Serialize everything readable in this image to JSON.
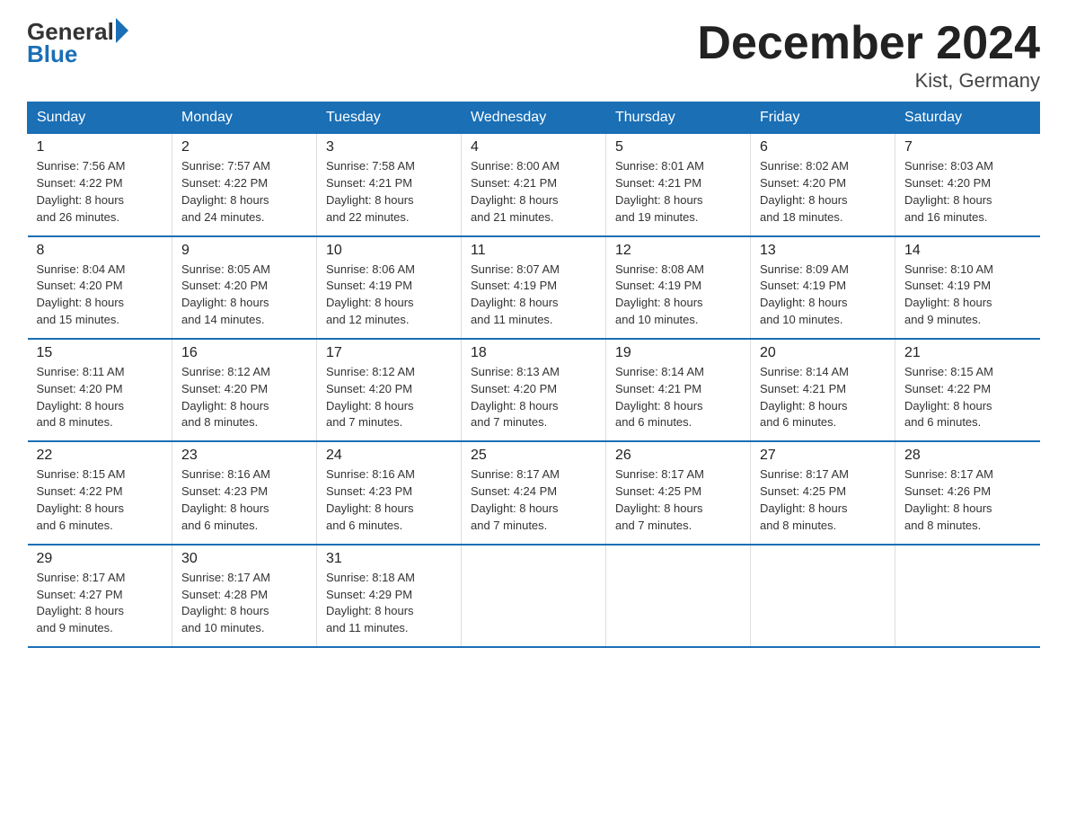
{
  "header": {
    "logo_general": "General",
    "logo_blue": "Blue",
    "month_title": "December 2024",
    "location": "Kist, Germany"
  },
  "weekdays": [
    "Sunday",
    "Monday",
    "Tuesday",
    "Wednesday",
    "Thursday",
    "Friday",
    "Saturday"
  ],
  "weeks": [
    [
      {
        "day": "1",
        "sunrise": "7:56 AM",
        "sunset": "4:22 PM",
        "daylight": "8 hours and 26 minutes."
      },
      {
        "day": "2",
        "sunrise": "7:57 AM",
        "sunset": "4:22 PM",
        "daylight": "8 hours and 24 minutes."
      },
      {
        "day": "3",
        "sunrise": "7:58 AM",
        "sunset": "4:21 PM",
        "daylight": "8 hours and 22 minutes."
      },
      {
        "day": "4",
        "sunrise": "8:00 AM",
        "sunset": "4:21 PM",
        "daylight": "8 hours and 21 minutes."
      },
      {
        "day": "5",
        "sunrise": "8:01 AM",
        "sunset": "4:21 PM",
        "daylight": "8 hours and 19 minutes."
      },
      {
        "day": "6",
        "sunrise": "8:02 AM",
        "sunset": "4:20 PM",
        "daylight": "8 hours and 18 minutes."
      },
      {
        "day": "7",
        "sunrise": "8:03 AM",
        "sunset": "4:20 PM",
        "daylight": "8 hours and 16 minutes."
      }
    ],
    [
      {
        "day": "8",
        "sunrise": "8:04 AM",
        "sunset": "4:20 PM",
        "daylight": "8 hours and 15 minutes."
      },
      {
        "day": "9",
        "sunrise": "8:05 AM",
        "sunset": "4:20 PM",
        "daylight": "8 hours and 14 minutes."
      },
      {
        "day": "10",
        "sunrise": "8:06 AM",
        "sunset": "4:19 PM",
        "daylight": "8 hours and 12 minutes."
      },
      {
        "day": "11",
        "sunrise": "8:07 AM",
        "sunset": "4:19 PM",
        "daylight": "8 hours and 11 minutes."
      },
      {
        "day": "12",
        "sunrise": "8:08 AM",
        "sunset": "4:19 PM",
        "daylight": "8 hours and 10 minutes."
      },
      {
        "day": "13",
        "sunrise": "8:09 AM",
        "sunset": "4:19 PM",
        "daylight": "8 hours and 10 minutes."
      },
      {
        "day": "14",
        "sunrise": "8:10 AM",
        "sunset": "4:19 PM",
        "daylight": "8 hours and 9 minutes."
      }
    ],
    [
      {
        "day": "15",
        "sunrise": "8:11 AM",
        "sunset": "4:20 PM",
        "daylight": "8 hours and 8 minutes."
      },
      {
        "day": "16",
        "sunrise": "8:12 AM",
        "sunset": "4:20 PM",
        "daylight": "8 hours and 8 minutes."
      },
      {
        "day": "17",
        "sunrise": "8:12 AM",
        "sunset": "4:20 PM",
        "daylight": "8 hours and 7 minutes."
      },
      {
        "day": "18",
        "sunrise": "8:13 AM",
        "sunset": "4:20 PM",
        "daylight": "8 hours and 7 minutes."
      },
      {
        "day": "19",
        "sunrise": "8:14 AM",
        "sunset": "4:21 PM",
        "daylight": "8 hours and 6 minutes."
      },
      {
        "day": "20",
        "sunrise": "8:14 AM",
        "sunset": "4:21 PM",
        "daylight": "8 hours and 6 minutes."
      },
      {
        "day": "21",
        "sunrise": "8:15 AM",
        "sunset": "4:22 PM",
        "daylight": "8 hours and 6 minutes."
      }
    ],
    [
      {
        "day": "22",
        "sunrise": "8:15 AM",
        "sunset": "4:22 PM",
        "daylight": "8 hours and 6 minutes."
      },
      {
        "day": "23",
        "sunrise": "8:16 AM",
        "sunset": "4:23 PM",
        "daylight": "8 hours and 6 minutes."
      },
      {
        "day": "24",
        "sunrise": "8:16 AM",
        "sunset": "4:23 PM",
        "daylight": "8 hours and 6 minutes."
      },
      {
        "day": "25",
        "sunrise": "8:17 AM",
        "sunset": "4:24 PM",
        "daylight": "8 hours and 7 minutes."
      },
      {
        "day": "26",
        "sunrise": "8:17 AM",
        "sunset": "4:25 PM",
        "daylight": "8 hours and 7 minutes."
      },
      {
        "day": "27",
        "sunrise": "8:17 AM",
        "sunset": "4:25 PM",
        "daylight": "8 hours and 8 minutes."
      },
      {
        "day": "28",
        "sunrise": "8:17 AM",
        "sunset": "4:26 PM",
        "daylight": "8 hours and 8 minutes."
      }
    ],
    [
      {
        "day": "29",
        "sunrise": "8:17 AM",
        "sunset": "4:27 PM",
        "daylight": "8 hours and 9 minutes."
      },
      {
        "day": "30",
        "sunrise": "8:17 AM",
        "sunset": "4:28 PM",
        "daylight": "8 hours and 10 minutes."
      },
      {
        "day": "31",
        "sunrise": "8:18 AM",
        "sunset": "4:29 PM",
        "daylight": "8 hours and 11 minutes."
      },
      null,
      null,
      null,
      null
    ]
  ]
}
